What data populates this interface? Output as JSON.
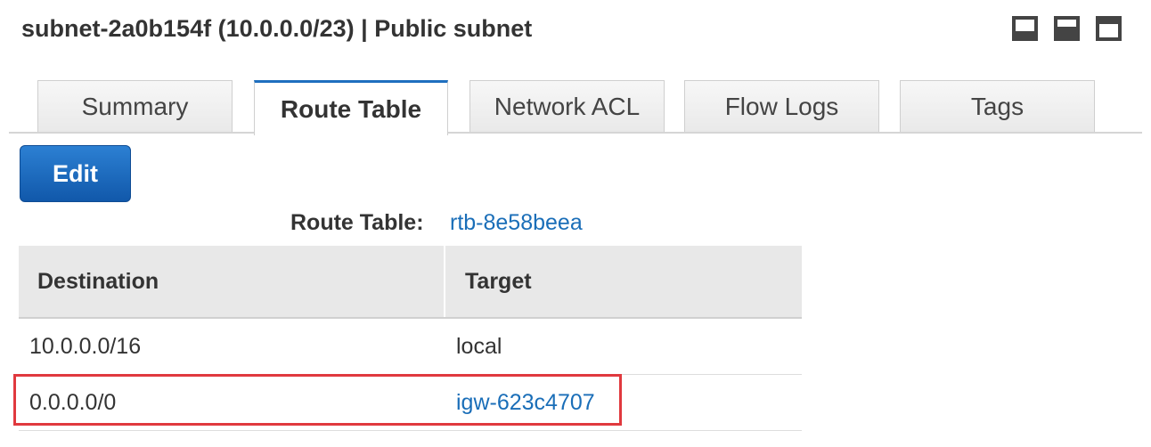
{
  "header": {
    "title": "subnet-2a0b154f (10.0.0.0/23) | Public subnet",
    "layout_icons": [
      "panel-bottom-icon",
      "panel-half-icon",
      "panel-full-icon"
    ]
  },
  "tabs": [
    {
      "label": "Summary",
      "active": false
    },
    {
      "label": "Route Table",
      "active": true
    },
    {
      "label": "Network ACL",
      "active": false
    },
    {
      "label": "Flow Logs",
      "active": false
    },
    {
      "label": "Tags",
      "active": false
    }
  ],
  "edit_button": {
    "label": "Edit"
  },
  "route_table": {
    "label": "Route Table:",
    "id": "rtb-8e58beea",
    "columns": [
      "Destination",
      "Target"
    ],
    "rows": [
      {
        "destination": "10.0.0.0/16",
        "target": "local",
        "target_is_link": false,
        "highlighted": false
      },
      {
        "destination": "0.0.0.0/0",
        "target": "igw-623c4707",
        "target_is_link": true,
        "highlighted": true
      }
    ]
  },
  "colors": {
    "accent": "#1f6fbf",
    "link": "#1a6eb8",
    "highlight_border": "#e0393e",
    "button_blue": "#1158aa"
  }
}
